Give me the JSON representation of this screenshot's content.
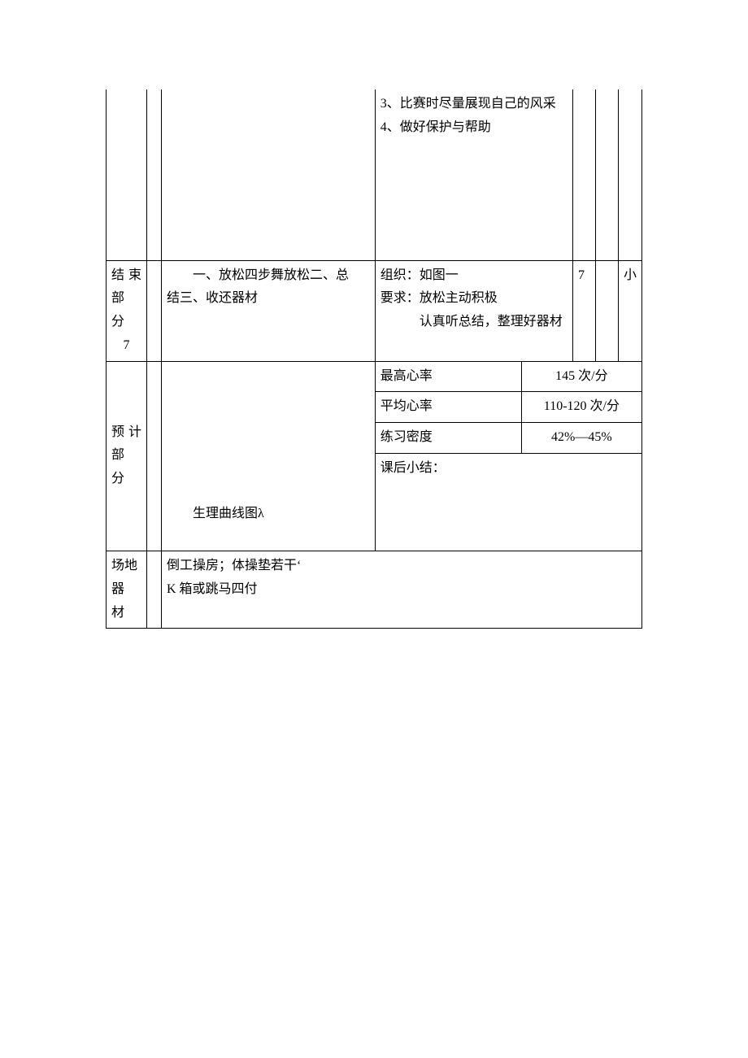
{
  "rows": {
    "r1": {
      "col3": {
        "line1": "3、比赛时尽量展现自己的风采",
        "line2": "4、做好保护与帮助"
      }
    },
    "r2": {
      "label_line1": "结束部",
      "label_line2": "分",
      "label_line3": "7",
      "col2": {
        "indent_text": "一、放松四步舞放松二、总",
        "line2": "结三、收还器材"
      },
      "col3": {
        "line1": "组织：如图一",
        "line2": "要求：放松主动积极",
        "line3": "认真听总结，整理好器材"
      },
      "col4": "7",
      "col6": "小"
    },
    "r3": {
      "label_line1": "预 计 部",
      "label_line2": "分",
      "curve_label": "生理曲线图λ",
      "metrics": {
        "m1_label": "最高心率",
        "m1_value": "145 次/分",
        "m2_label": "平均心率",
        "m2_value": "110-120 次/分",
        "m3_label": "练习密度",
        "m3_value": "42%—45%",
        "m4_label": "课后小结："
      }
    },
    "r4": {
      "label_line1": "场地",
      "label_line2": "器",
      "label_line3": "材",
      "content_line1": "倒工操房；体操垫若干‘",
      "content_line2": "K 箱或跳马四付"
    }
  }
}
